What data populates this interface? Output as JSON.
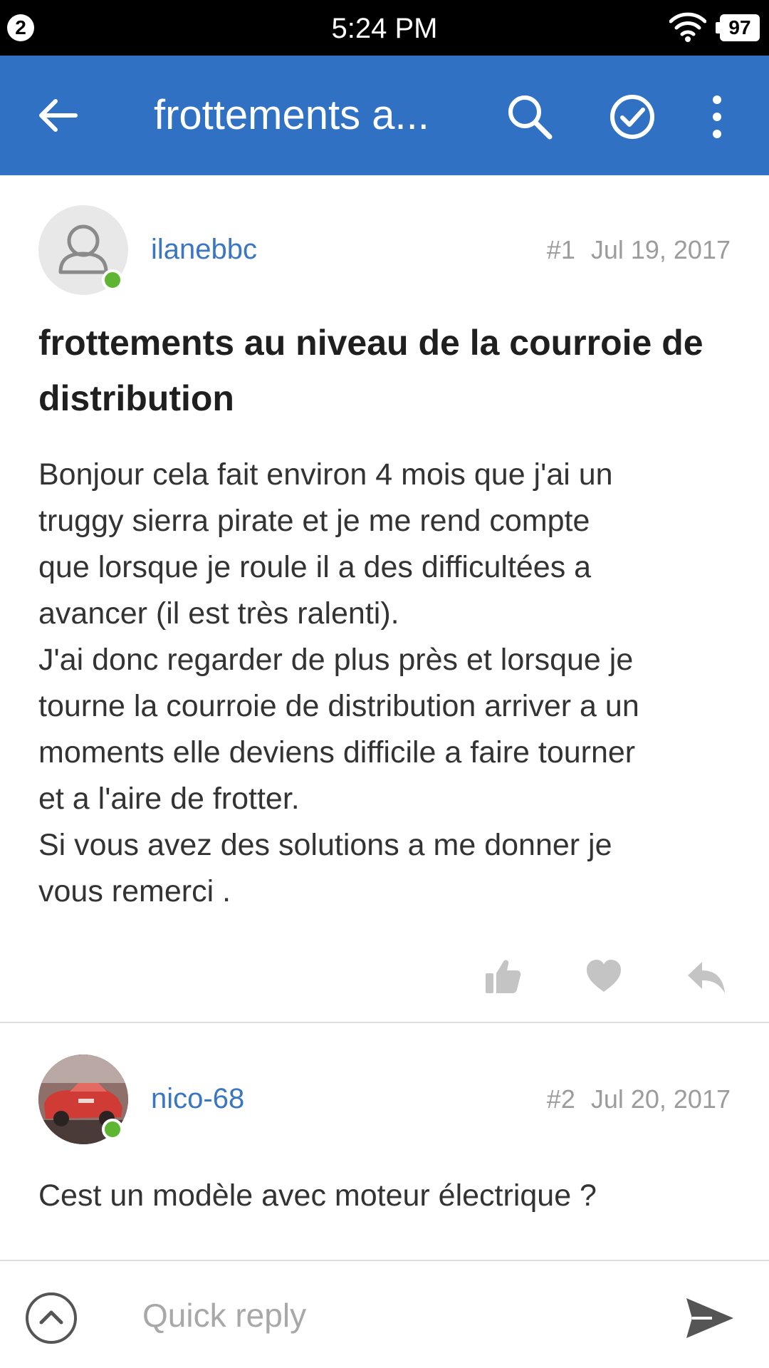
{
  "status_bar": {
    "notification_count": "2",
    "time": "5:24 PM",
    "battery": "97",
    "icons": [
      "wifi-icon",
      "battery-icon"
    ]
  },
  "app_bar": {
    "title": "frottements a...",
    "icons": [
      "back-arrow-icon",
      "search-icon",
      "check-circle-icon",
      "more-vert-icon"
    ],
    "color": "#3071c3"
  },
  "posts": [
    {
      "username": "ilanebbc",
      "number": "#1",
      "date": "Jul 19, 2017",
      "online": true,
      "avatar": "default-user-icon",
      "title": "frottements au niveau de la courroie de distribution",
      "body": [
        "Bonjour cela fait environ 4 mois que j'ai un",
        "truggy sierra pirate et je me rend compte",
        "que lorsque je roule il a des difficultées a",
        "avancer (il est très ralenti).",
        "J'ai donc regarder de plus près et lorsque je",
        "tourne la courroie de distribution arriver a un",
        "moments elle deviens difficile a faire tourner",
        "et a l'aire de frotter.",
        "Si vous avez des solutions a me donner je",
        "vous remerci ."
      ],
      "actions": [
        "thumbs-up-icon",
        "heart-icon",
        "reply-icon"
      ]
    },
    {
      "username": "nico-68",
      "number": "#2",
      "date": "Jul 20, 2017",
      "online": true,
      "avatar": "red-car-photo",
      "body": "Cest un modèle avec moteur électrique ?"
    }
  ],
  "quick_reply": {
    "placeholder": "Quick reply",
    "icons": [
      "expand-up-icon",
      "send-icon"
    ]
  },
  "colors": {
    "accent": "#3071c3",
    "username": "#3a76c2",
    "online": "#5db531"
  }
}
